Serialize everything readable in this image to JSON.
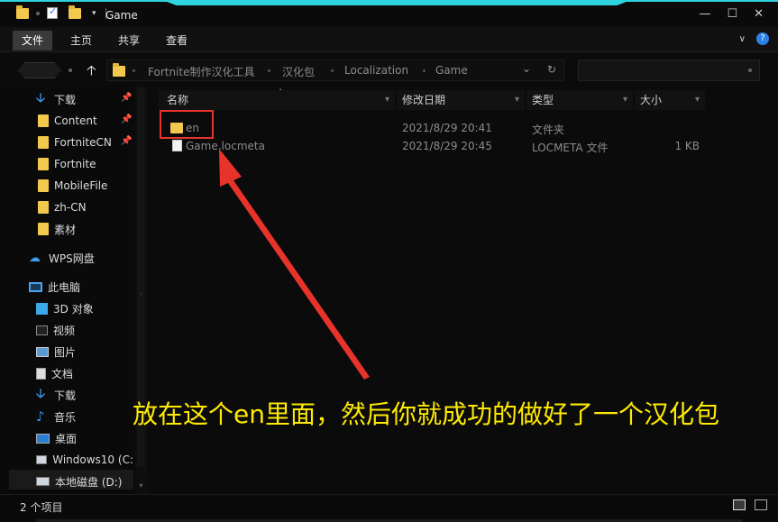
{
  "window": {
    "title": "Game"
  },
  "ribbon": {
    "tabs": [
      "文件",
      "主页",
      "共享",
      "查看"
    ],
    "active_tab": "文件"
  },
  "address": {
    "crumbs": [
      "Fortnite制作汉化工具",
      "汉化包",
      "Localization",
      "Game"
    ]
  },
  "sidebar": {
    "items": [
      {
        "label": "下载",
        "icon": "download-icon",
        "pinned": true
      },
      {
        "label": "Content",
        "icon": "folder-icon",
        "pinned": true
      },
      {
        "label": "FortniteCN",
        "icon": "folder-icon",
        "pinned": true
      },
      {
        "label": "Fortnite",
        "icon": "folder-icon",
        "pinned": false
      },
      {
        "label": "MobileFile",
        "icon": "folder-icon",
        "pinned": false
      },
      {
        "label": "zh-CN",
        "icon": "folder-icon",
        "pinned": false
      },
      {
        "label": "素材",
        "icon": "folder-icon",
        "pinned": false
      },
      {
        "label": "WPS网盘",
        "icon": "cloud-icon",
        "pinned": false
      },
      {
        "label": "此电脑",
        "icon": "computer-icon",
        "pinned": false
      },
      {
        "label": "3D 对象",
        "icon": "3d-objects-icon",
        "pinned": false
      },
      {
        "label": "视频",
        "icon": "video-icon",
        "pinned": false
      },
      {
        "label": "图片",
        "icon": "picture-icon",
        "pinned": false
      },
      {
        "label": "文档",
        "icon": "document-icon",
        "pinned": false
      },
      {
        "label": "下载",
        "icon": "download-icon",
        "pinned": false
      },
      {
        "label": "音乐",
        "icon": "music-icon",
        "pinned": false
      },
      {
        "label": "桌面",
        "icon": "desktop-icon",
        "pinned": false
      },
      {
        "label": "Windows10 (C:",
        "icon": "drive-icon",
        "pinned": false
      },
      {
        "label": "本地磁盘 (D:)",
        "icon": "drive-icon",
        "pinned": false
      }
    ]
  },
  "columns": {
    "name": "名称",
    "modified": "修改日期",
    "type": "类型",
    "size": "大小"
  },
  "files": [
    {
      "name": "en",
      "modified": "2021/8/29 20:41",
      "type": "文件夹",
      "size": "",
      "icon": "folder-icon"
    },
    {
      "name": "Game.locmeta",
      "modified": "2021/8/29 20:45",
      "type": "LOCMETA 文件",
      "size": "1 KB",
      "icon": "file-icon"
    }
  ],
  "annotation": {
    "text": "放在这个en里面，然后你就成功的做好了一个汉化包",
    "color": "#ffea00",
    "arrow_color": "#e8332b"
  },
  "status": {
    "item_count": "2 个项目"
  }
}
